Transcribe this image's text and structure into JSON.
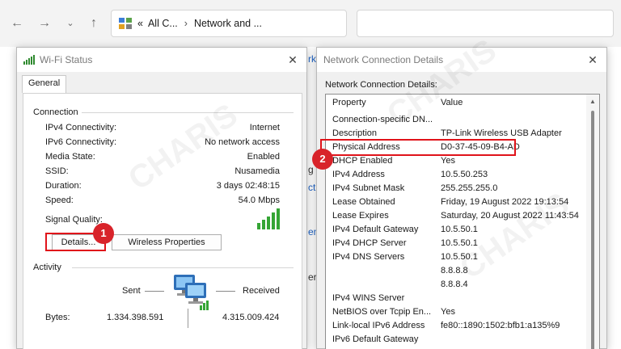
{
  "explorer": {
    "address_prefix": "«",
    "address_part1": "All C...",
    "address_part2": "Network and ...",
    "bg_fragments": [
      "rk",
      "g",
      "ct",
      "en",
      "er"
    ]
  },
  "wifi_status": {
    "title": "Wi-Fi Status",
    "tab": "General",
    "connection_label": "Connection",
    "rows": [
      {
        "label": "IPv4 Connectivity:",
        "value": "Internet"
      },
      {
        "label": "IPv6 Connectivity:",
        "value": "No network access"
      },
      {
        "label": "Media State:",
        "value": "Enabled"
      },
      {
        "label": "SSID:",
        "value": "Nusamedia"
      },
      {
        "label": "Duration:",
        "value": "3 days 02:48:15"
      },
      {
        "label": "Speed:",
        "value": "54.0 Mbps"
      }
    ],
    "signal_label": "Signal Quality:",
    "details_button": "Details...",
    "wireless_button": "Wireless Properties",
    "activity_label": "Activity",
    "sent_label": "Sent",
    "received_label": "Received",
    "bytes_label": "Bytes:",
    "bytes_sent": "1.334.398.591",
    "bytes_received": "4.315.009.424",
    "badge": "1"
  },
  "net_details": {
    "title": "Network Connection Details",
    "caption": "Network Connection Details:",
    "col_property": "Property",
    "col_value": "Value",
    "rows": [
      {
        "p": "Connection-specific DN...",
        "v": ""
      },
      {
        "p": "Description",
        "v": "TP-Link Wireless USB Adapter"
      },
      {
        "p": "Physical Address",
        "v": "D0-37-45-09-B4-AD"
      },
      {
        "p": "DHCP Enabled",
        "v": "Yes"
      },
      {
        "p": "IPv4 Address",
        "v": "10.5.50.253"
      },
      {
        "p": "IPv4 Subnet Mask",
        "v": "255.255.255.0"
      },
      {
        "p": "Lease Obtained",
        "v": "Friday, 19 August 2022 19:13:54"
      },
      {
        "p": "Lease Expires",
        "v": "Saturday, 20 August 2022 11:43:54"
      },
      {
        "p": "IPv4 Default Gateway",
        "v": "10.5.50.1"
      },
      {
        "p": "IPv4 DHCP Server",
        "v": "10.5.50.1"
      },
      {
        "p": "IPv4 DNS Servers",
        "v": "10.5.50.1"
      },
      {
        "p": "",
        "v": "8.8.8.8"
      },
      {
        "p": "",
        "v": "8.8.8.4"
      },
      {
        "p": "IPv4 WINS Server",
        "v": ""
      },
      {
        "p": "NetBIOS over Tcpip En...",
        "v": "Yes"
      },
      {
        "p": "Link-local IPv6 Address",
        "v": "fe80::1890:1502:bfb1:a135%9"
      },
      {
        "p": "IPv6 Default Gateway",
        "v": ""
      }
    ],
    "badge": "2"
  },
  "watermark": "CHARIS"
}
